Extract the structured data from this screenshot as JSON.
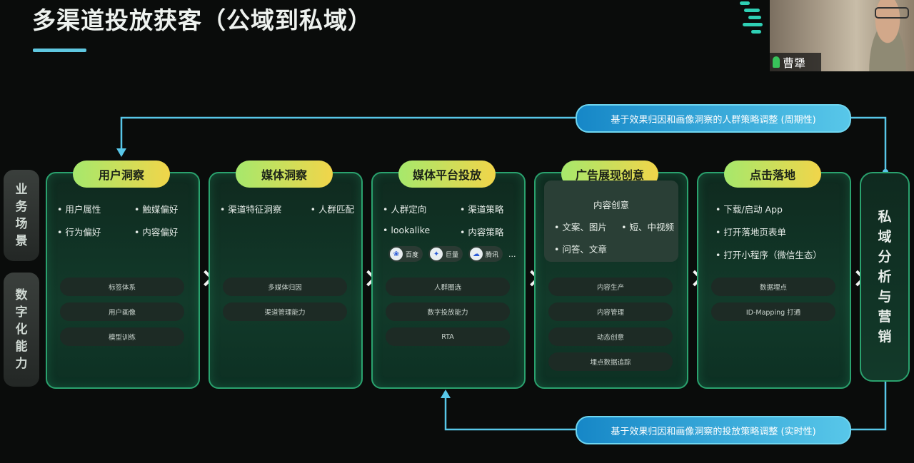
{
  "title": "多渠道投放获客（公域到私域）",
  "video": {
    "name": "曹犟"
  },
  "side_labels": [
    "业务场景",
    "数字化能力"
  ],
  "columns": [
    {
      "title": "用户洞察",
      "bullets": [
        [
          "用户属性",
          "触媒偏好"
        ],
        [
          "行为偏好",
          "内容偏好"
        ]
      ],
      "pills": [
        "标签体系",
        "用户画像",
        "模型训练"
      ]
    },
    {
      "title": "媒体洞察",
      "bullets": [
        [
          "渠道特征洞察",
          "人群匹配"
        ]
      ],
      "pills": [
        "多媒体归因",
        "渠道管理能力"
      ]
    },
    {
      "title": "媒体平台投放",
      "bullets": [
        [
          "人群定向",
          "渠道策略"
        ],
        [
          "lookalike",
          "内容策略"
        ]
      ],
      "logos": [
        "百度",
        "巨量",
        "腾讯"
      ],
      "logos_more": "...",
      "pills": [
        "人群圈选",
        "数字投放能力",
        "RTA"
      ]
    },
    {
      "title": "广告展现创意",
      "card_title": "内容创意",
      "card_lines": [
        [
          "文案、图片",
          "短、中视频"
        ],
        [
          "问答、文章",
          ""
        ]
      ],
      "pills": [
        "内容生产",
        "内容管理",
        "动态创意",
        "埋点数据追踪"
      ]
    },
    {
      "title": "点击落地",
      "bullets": [
        [
          "下载/启动 App"
        ],
        [
          "打开落地页表单"
        ],
        [
          "打开小程序（微信生态）"
        ]
      ],
      "pills": [
        "数据埋点",
        "ID-Mapping 打通"
      ]
    }
  ],
  "right_panel": "私域分析与营销",
  "top_banner": "基于效果归因和画像洞察的人群策略调整 (周期性)",
  "bottom_banner": "基于效果归因和画像洞察的投放策略调整 (实时性)"
}
